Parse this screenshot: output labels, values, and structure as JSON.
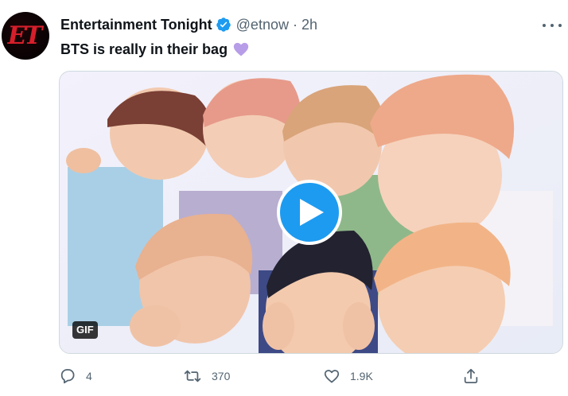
{
  "author": {
    "avatar_text": "ET",
    "name": "Entertainment Tonight",
    "verified": true,
    "handle": "@etnow",
    "separator": "·",
    "time": "2h"
  },
  "tweet": {
    "text": "BTS is really in their bag",
    "emoji": "purple-heart"
  },
  "media": {
    "type": "animated GIF",
    "badge": "GIF",
    "play_icon": "play-icon"
  },
  "actions": {
    "reply_count": "4",
    "retweet_count": "370",
    "like_count": "1.9K"
  },
  "colors": {
    "accent": "#1d9bf0",
    "muted_text": "#536471",
    "primary_text": "#0f1419",
    "heart_emoji": "#b79de8",
    "avatar_logo": "#d61f2b"
  }
}
